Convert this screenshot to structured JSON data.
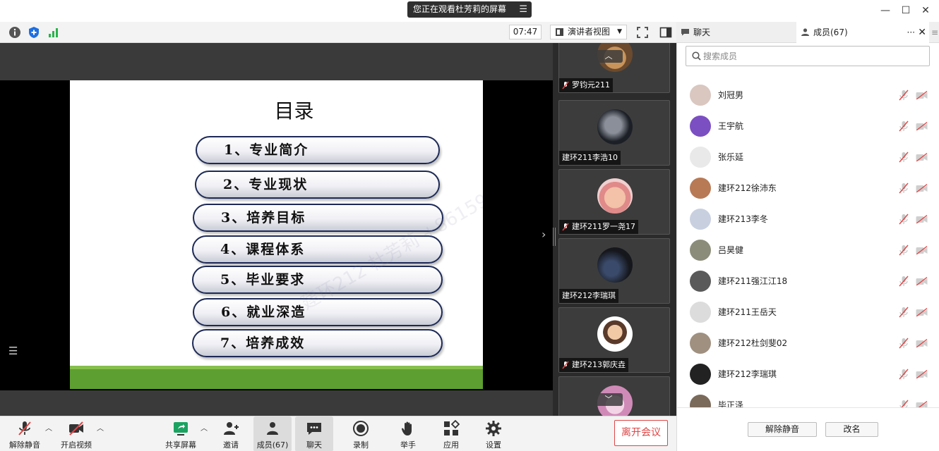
{
  "title_bar": {
    "share_status": "您正在观看杜芳莉的屏幕",
    "minimize_glyph": "—",
    "maximize_glyph": "☐",
    "close_glyph": "✕"
  },
  "toolbar": {
    "timer": "07:47",
    "view_mode": "演讲者视图",
    "info_icon": "info-icon",
    "security_icon": "shield-icon",
    "signal_icon": "signal-icon"
  },
  "tabs": {
    "chat": "聊天",
    "members": "成员(67)",
    "more": "···",
    "close": "✕",
    "menu": "≡"
  },
  "slide": {
    "title": "目录",
    "items": [
      "1、专业简介",
      "2、专业现状",
      "3、培养目标",
      "4、课程体系",
      "5、毕业要求",
      "6、就业深造",
      "7、培养成效"
    ],
    "watermark": "建环212  杜芳莉 +8615967027370",
    "accent": "#5d9f31",
    "pill_border": "#1d2a56"
  },
  "thumbnails": {
    "scroll_up": "︿",
    "scroll_down": "﹀",
    "items": [
      {
        "name": "罗钧元211",
        "muted": true
      },
      {
        "name": "建环211李浩10",
        "muted": false
      },
      {
        "name": "建环211罗一尧17",
        "muted": true
      },
      {
        "name": "建环212李瑞琪",
        "muted": false
      },
      {
        "name": "建环213郭庆垚",
        "muted": true
      },
      {
        "name": "",
        "muted": false
      }
    ]
  },
  "bottom_bar": {
    "unmute": "解除静音",
    "start_video": "开启视频",
    "share_screen": "共享屏幕",
    "invite": "邀请",
    "members": "成员(67)",
    "chat": "聊天",
    "record": "录制",
    "raise_hand": "举手",
    "apps": "应用",
    "settings": "设置",
    "leave": "离开会议",
    "leave_color": "#e04545"
  },
  "members_panel": {
    "search_placeholder": "搜索成员",
    "members": [
      {
        "name": "刘冠男",
        "avatar": "#d9c7c0"
      },
      {
        "name": "王宇航",
        "avatar": "#7b4fc2"
      },
      {
        "name": "张乐延",
        "avatar": "#e9e9e9"
      },
      {
        "name": "建环212徐沛东",
        "avatar": "#b77a55"
      },
      {
        "name": "建环213李冬",
        "avatar": "#c8d0e0"
      },
      {
        "name": "吕昊健",
        "avatar": "#8c8c7a"
      },
      {
        "name": "建环211强江江18",
        "avatar": "#5a5a5a"
      },
      {
        "name": "建环211王岳天",
        "avatar": "#dcdcdc"
      },
      {
        "name": "建环212杜剑斐02",
        "avatar": "#a09080"
      },
      {
        "name": "建环212李瑞琪",
        "avatar": "#222222"
      },
      {
        "name": "毕正泽",
        "avatar": "#7a6a5a"
      }
    ],
    "unmute_button": "解除静音",
    "rename_button": "改名"
  }
}
